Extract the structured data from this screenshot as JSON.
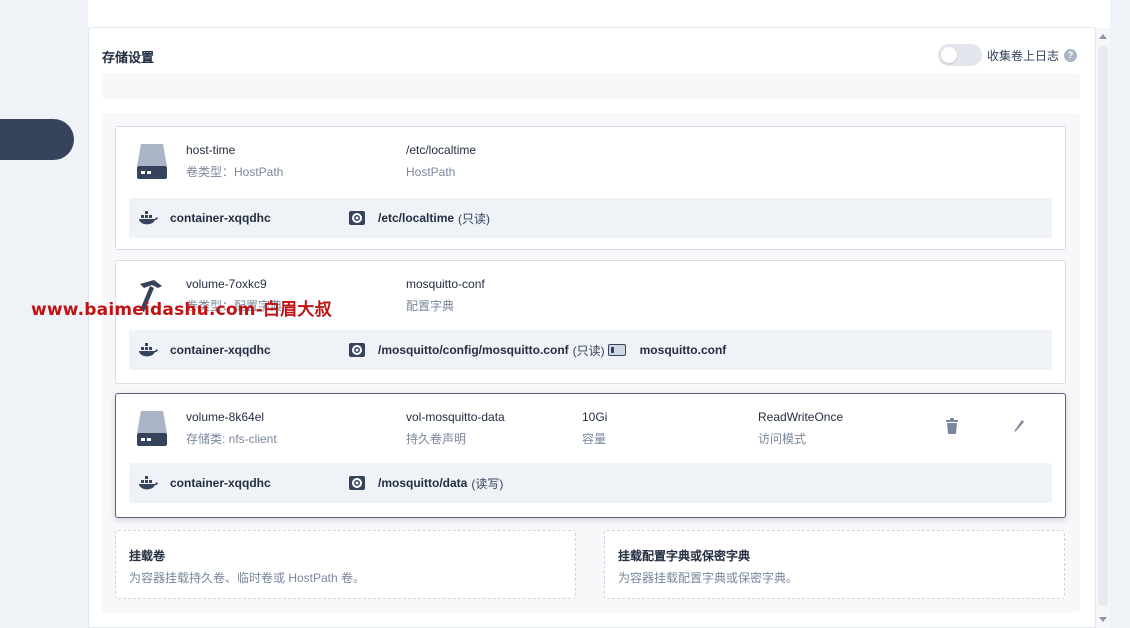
{
  "panel": {
    "title": "存储设置",
    "toggle_label": "收集卷上日志",
    "help": "?"
  },
  "volumes": [
    {
      "name": "host-time",
      "type_text": "卷类型：HostPath",
      "source": "/etc/localtime",
      "source_sub": "HostPath",
      "icon": "disk-icon",
      "mount": {
        "container": "container-xqqdhc",
        "path": "/etc/localtime",
        "mode": "(只读)"
      }
    },
    {
      "name": "volume-7oxkc9",
      "type_text": "卷类型：配置字典",
      "source": "mosquitto-conf",
      "source_sub": "配置字典",
      "icon": "hammer-icon",
      "mount": {
        "container": "container-xqqdhc",
        "path": "/mosquitto/config/mosquitto.conf",
        "mode": "(只读)",
        "file": "mosquitto.conf"
      }
    },
    {
      "name": "volume-8k64el",
      "type_text": "存储类: nfs-client",
      "source": "vol-mosquitto-data",
      "source_sub": "持久卷声明",
      "capacity": "10Gi",
      "capacity_sub": "容量",
      "access": "ReadWriteOnce",
      "access_sub": "访问模式",
      "icon": "disk-icon",
      "mount": {
        "container": "container-xqqdhc",
        "path": "/mosquitto/data",
        "mode": "(读写)"
      }
    }
  ],
  "add_volume": {
    "title": "挂载卷",
    "desc": "为容器挂载持久卷、临时卷或 HostPath 卷。"
  },
  "add_config": {
    "title": "挂载配置字典或保密字典",
    "desc": "为容器挂载配置字典或保密字典。"
  },
  "watermark": "www.baimeidashu.com-白眉大叔",
  "colors": {
    "accent_dark": "#36435c",
    "text_main": "#242e42",
    "text_muted": "#79879c",
    "watermark": "#c01212"
  }
}
